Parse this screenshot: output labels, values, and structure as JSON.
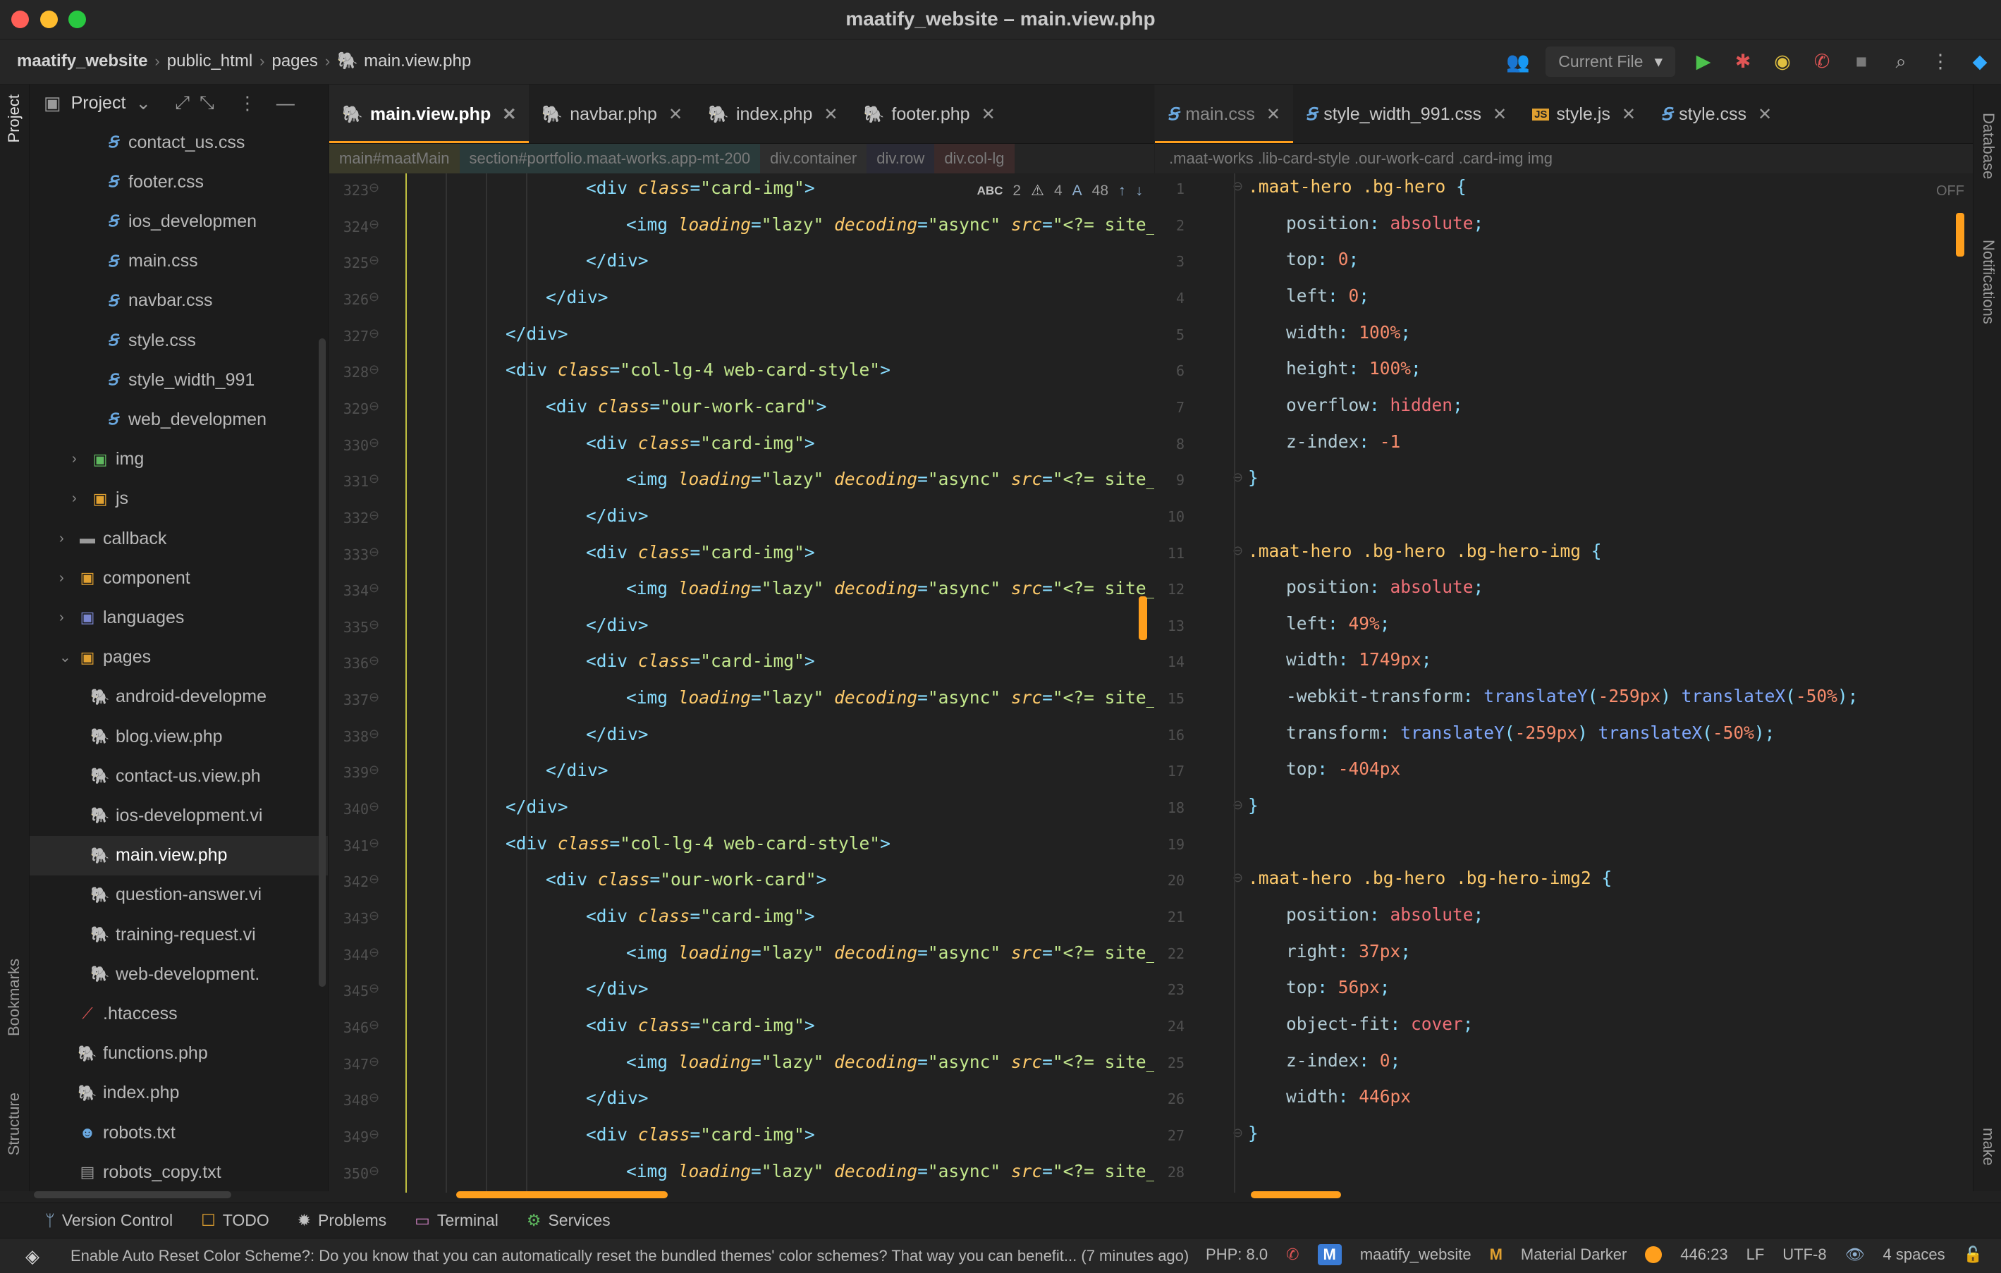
{
  "window": {
    "title": "maatify_website – main.view.php",
    "colors": {
      "close": "#ff5f57",
      "minimize": "#febc2e",
      "maximize": "#28c840",
      "accent": "#ff9f1c"
    }
  },
  "breadcrumb": [
    "maatify_website",
    "public_html",
    "pages",
    "main.view.php"
  ],
  "toolbar": {
    "run_config": "Current File",
    "icons": [
      "users-icon",
      "run-icon",
      "debug-icon",
      "coverage-icon",
      "phone-icon",
      "stop-icon",
      "search-icon",
      "more-icon",
      "jetbrains-icon"
    ]
  },
  "left_strip": {
    "project": "Project",
    "bookmarks": "Bookmarks",
    "structure": "Structure"
  },
  "right_strip": {
    "database": "Database",
    "notifications": "Notifications",
    "make": "make"
  },
  "project_panel": {
    "title": "Project",
    "items": [
      {
        "label": "contact_us.css",
        "type": "css",
        "indent": 4
      },
      {
        "label": "footer.css",
        "type": "css",
        "indent": 4
      },
      {
        "label": "ios_developmen",
        "type": "css",
        "indent": 4
      },
      {
        "label": "main.css",
        "type": "css",
        "indent": 4
      },
      {
        "label": "navbar.css",
        "type": "css",
        "indent": 4
      },
      {
        "label": "style.css",
        "type": "css",
        "indent": 4
      },
      {
        "label": "style_width_991",
        "type": "css",
        "indent": 4
      },
      {
        "label": "web_developmen",
        "type": "css",
        "indent": 4
      },
      {
        "label": "img",
        "type": "folder-img",
        "indent": 3,
        "arrow": "›"
      },
      {
        "label": "js",
        "type": "folder-js",
        "indent": 3,
        "arrow": "›"
      },
      {
        "label": "callback",
        "type": "folder",
        "indent": 2,
        "arrow": "›"
      },
      {
        "label": "component",
        "type": "folder-comp",
        "indent": 2,
        "arrow": "›"
      },
      {
        "label": "languages",
        "type": "folder-lang",
        "indent": 2,
        "arrow": "›"
      },
      {
        "label": "pages",
        "type": "folder-open",
        "indent": 2,
        "arrow": "⌄"
      },
      {
        "label": "android-developme",
        "type": "php",
        "indent": 3
      },
      {
        "label": "blog.view.php",
        "type": "php",
        "indent": 3
      },
      {
        "label": "contact-us.view.ph",
        "type": "php",
        "indent": 3
      },
      {
        "label": "ios-development.vi",
        "type": "php",
        "indent": 3
      },
      {
        "label": "main.view.php",
        "type": "php",
        "indent": 3,
        "selected": true
      },
      {
        "label": "question-answer.vi",
        "type": "php",
        "indent": 3
      },
      {
        "label": "training-request.vi",
        "type": "php",
        "indent": 3
      },
      {
        "label": "web-development.",
        "type": "php",
        "indent": 3
      },
      {
        "label": ".htaccess",
        "type": "feather",
        "indent": 2
      },
      {
        "label": "functions.php",
        "type": "php",
        "indent": 2
      },
      {
        "label": "index.php",
        "type": "php",
        "indent": 2
      },
      {
        "label": "robots.txt",
        "type": "robot",
        "indent": 2
      },
      {
        "label": "robots_copy.txt",
        "type": "txt",
        "indent": 2
      }
    ]
  },
  "left_editor": {
    "tabs": [
      {
        "label": "main.view.php",
        "active": true
      },
      {
        "label": "navbar.php"
      },
      {
        "label": "index.php"
      },
      {
        "label": "footer.php"
      }
    ],
    "breadcrumb": [
      "main#maatMain",
      "section#portfolio.maat-works.app-mt-200",
      "div.container",
      "div.row",
      "div.col-lg"
    ],
    "inspections": {
      "typos": "2",
      "warnings": "4",
      "weak": "48"
    },
    "first_line": 323,
    "lines": [
      {
        "indent": 6,
        "kind": "open",
        "cls": "card-img"
      },
      {
        "indent": 7,
        "kind": "img"
      },
      {
        "indent": 6,
        "kind": "close"
      },
      {
        "indent": 5,
        "kind": "close"
      },
      {
        "indent": 4,
        "kind": "close"
      },
      {
        "indent": 4,
        "kind": "open",
        "cls": "col-lg-4 web-card-style"
      },
      {
        "indent": 5,
        "kind": "open",
        "cls": "our-work-card"
      },
      {
        "indent": 6,
        "kind": "open",
        "cls": "card-img"
      },
      {
        "indent": 7,
        "kind": "img"
      },
      {
        "indent": 6,
        "kind": "close"
      },
      {
        "indent": 6,
        "kind": "open",
        "cls": "card-img"
      },
      {
        "indent": 7,
        "kind": "img"
      },
      {
        "indent": 6,
        "kind": "close"
      },
      {
        "indent": 6,
        "kind": "open",
        "cls": "card-img"
      },
      {
        "indent": 7,
        "kind": "img"
      },
      {
        "indent": 6,
        "kind": "close"
      },
      {
        "indent": 5,
        "kind": "close"
      },
      {
        "indent": 4,
        "kind": "close"
      },
      {
        "indent": 4,
        "kind": "open",
        "cls": "col-lg-4 web-card-style"
      },
      {
        "indent": 5,
        "kind": "open",
        "cls": "our-work-card"
      },
      {
        "indent": 6,
        "kind": "open",
        "cls": "card-img"
      },
      {
        "indent": 7,
        "kind": "img"
      },
      {
        "indent": 6,
        "kind": "close"
      },
      {
        "indent": 6,
        "kind": "open",
        "cls": "card-img"
      },
      {
        "indent": 7,
        "kind": "img"
      },
      {
        "indent": 6,
        "kind": "close"
      },
      {
        "indent": 6,
        "kind": "open",
        "cls": "card-img"
      },
      {
        "indent": 7,
        "kind": "img"
      }
    ],
    "img_text": {
      "tag": "<img",
      "a1": "loading",
      "v1": "\"lazy\"",
      "a2": "decoding",
      "v2": "\"async\"",
      "a3": "src",
      "v3": "\"<?= site_ur"
    },
    "div_open": "<div",
    "div_close": "</div>",
    "class_attr": "class"
  },
  "right_editor": {
    "tabs": [
      {
        "label": "main.css",
        "active": true
      },
      {
        "label": "style_width_991.css"
      },
      {
        "label": "style.js"
      },
      {
        "label": "style.css"
      }
    ],
    "breadcrumb": ".maat-works .lib-card-style .our-work-card .card-img img",
    "readonly_flag": "OFF",
    "lines": [
      {
        "sel": ".maat-hero .bg-hero {"
      },
      {
        "prop": "position",
        "val": "absolute"
      },
      {
        "prop": "top",
        "val": "0"
      },
      {
        "prop": "left",
        "val": "0"
      },
      {
        "prop": "width",
        "val": "100%"
      },
      {
        "prop": "height",
        "val": "100%"
      },
      {
        "prop": "overflow",
        "val": "hidden"
      },
      {
        "prop": "z-index",
        "val": "-1",
        "nosemi": true
      },
      {
        "close": "}"
      },
      {
        "blank": true
      },
      {
        "sel": ".maat-hero .bg-hero .bg-hero-img {"
      },
      {
        "prop": "position",
        "val": "absolute"
      },
      {
        "prop": "left",
        "val": "49%"
      },
      {
        "prop": "width",
        "val": "1749px"
      },
      {
        "prop": "-webkit-transform",
        "val": "translateY(-259px) translateX(-50%)"
      },
      {
        "prop": "transform",
        "val": "translateY(-259px) translateX(-50%)"
      },
      {
        "prop": "top",
        "val": "-404px",
        "nosemi": true
      },
      {
        "close": "}"
      },
      {
        "blank": true
      },
      {
        "sel": ".maat-hero .bg-hero .bg-hero-img2 {"
      },
      {
        "prop": "position",
        "val": "absolute"
      },
      {
        "prop": "right",
        "val": "37px"
      },
      {
        "prop": "top",
        "val": "56px"
      },
      {
        "prop": "object-fit",
        "val": "cover"
      },
      {
        "prop": "z-index",
        "val": "0"
      },
      {
        "prop": "width",
        "val": "446px",
        "nosemi": true
      },
      {
        "close": "}"
      },
      {
        "blank": true
      }
    ]
  },
  "bottom_tools": [
    {
      "label": "Version Control",
      "icon": "branch-icon"
    },
    {
      "label": "TODO",
      "icon": "todo-icon"
    },
    {
      "label": "Problems",
      "icon": "bug-icon"
    },
    {
      "label": "Terminal",
      "icon": "terminal-icon"
    },
    {
      "label": "Services",
      "icon": "gear-icon"
    }
  ],
  "status": {
    "message": "Enable Auto Reset Color Scheme?: Do you know that you can automatically reset the bundled themes' color schemes? That way you can benefit... (7 minutes ago)",
    "php": "PHP: 8.0",
    "project_badge": "M",
    "project": "maatify_website",
    "theme": "Material Darker",
    "position": "446:23",
    "line_sep": "LF",
    "encoding": "UTF-8",
    "indent": "4 spaces"
  }
}
